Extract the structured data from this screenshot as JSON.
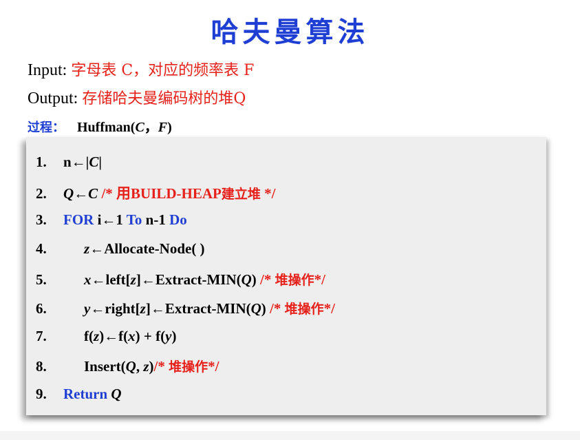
{
  "title": "哈夫曼算法",
  "input": {
    "label": "Input:",
    "value": "字母表 C，对应的频率表 F"
  },
  "output": {
    "label": "Output:",
    "value": "存储哈夫曼编码树的堆Q"
  },
  "process": {
    "label": "过程：",
    "func": "Huffman(",
    "arg1": "C",
    "sep": "，",
    "arg2": "F",
    "close": ")"
  },
  "code": {
    "l1": {
      "num": "1.",
      "a": "n←|",
      "b": "C",
      "c": "|"
    },
    "l2": {
      "num": "2.",
      "a": "Q",
      "b": "←",
      "c": "C",
      "comment_a": "/* 用BUILD-HEAP",
      "comment_b": "建立堆",
      "comment_c": " */"
    },
    "l3": {
      "num": "3.",
      "kw1": "FOR",
      "a": " i←1 ",
      "kw2": "To",
      "b": " n-1 ",
      "kw3": "Do"
    },
    "l4": {
      "num": "4.",
      "a": "z",
      "b": "←Allocate-Node( )"
    },
    "l5": {
      "num": "5.",
      "a": "x",
      "b": "←left[",
      "c": "z",
      "d": "]←Extract-MIN(",
      "e": "Q",
      "f": ") ",
      "comment_a": "/* ",
      "comment_b": "堆操作",
      "comment_c": "*/"
    },
    "l6": {
      "num": "6.",
      "a": "y",
      "b": "←right[",
      "c": "z",
      "d": "]←Extract-MIN(",
      "e": "Q",
      "f": ") ",
      "comment_a": "/* ",
      "comment_b": "堆操作",
      "comment_c": "*/"
    },
    "l7": {
      "num": "7.",
      "a": "f(",
      "b": "z",
      "c": ")←f(",
      "d": "x",
      "e": ") + f(",
      "f": "y",
      "g": ")"
    },
    "l8": {
      "num": "8.",
      "a": "Insert(",
      "b": "Q",
      "c": ", ",
      "d": "z",
      "e": ")",
      "comment_a": "/* ",
      "comment_b": "堆操作",
      "comment_c": "*/"
    },
    "l9": {
      "num": "9.",
      "kw": "Return",
      "a": " ",
      "b": "Q"
    }
  }
}
